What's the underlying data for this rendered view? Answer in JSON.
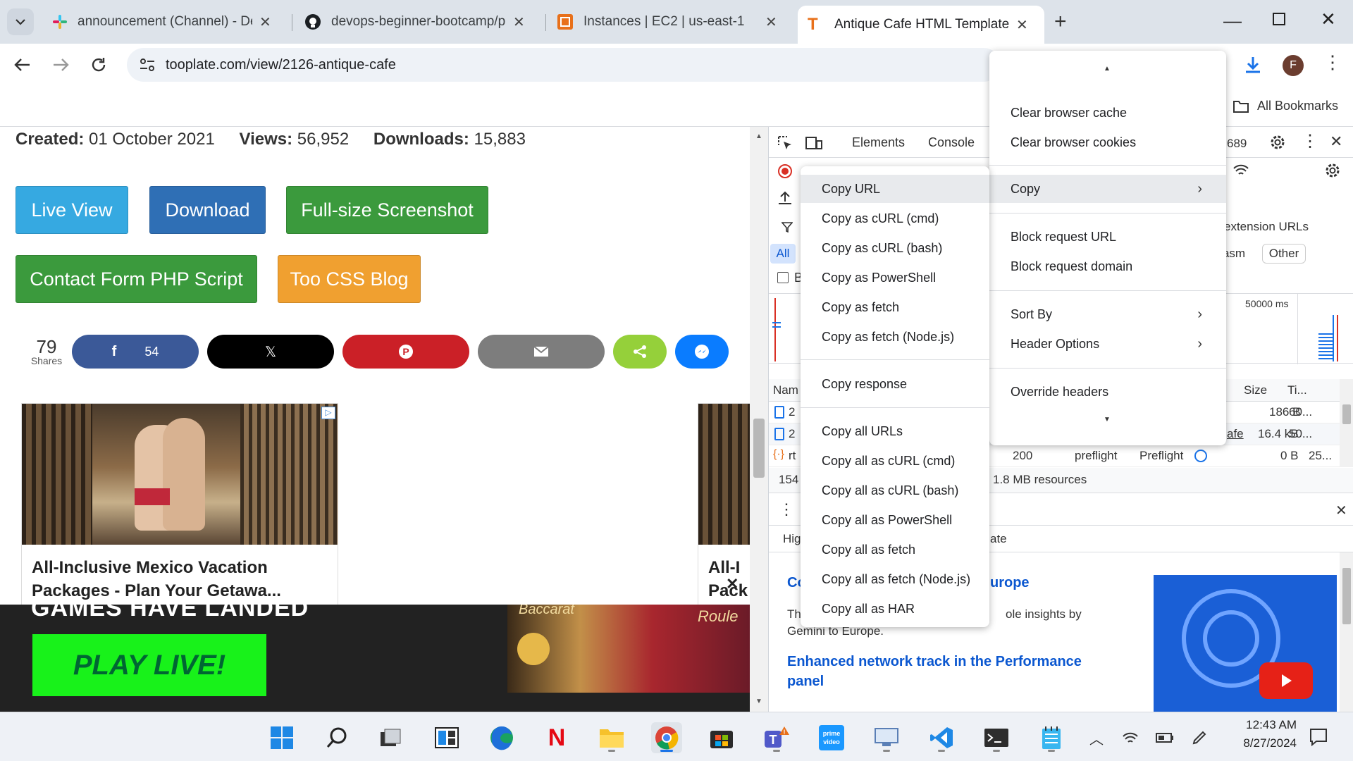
{
  "browser": {
    "tabs": [
      {
        "title": "announcement (Channel) - Dev",
        "icon": "slack-icon"
      },
      {
        "title": "devops-beginner-bootcamp/pr",
        "icon": "github-icon"
      },
      {
        "title": "Instances | EC2 | us-east-1",
        "icon": "aws-icon"
      },
      {
        "title": "Antique Cafe HTML Template b",
        "icon": "tooplate-icon"
      }
    ],
    "new_tab": "+",
    "url": "tooplate.com/view/2126-antique-cafe",
    "profile_initial": "F",
    "bookmarks_label": "All Bookmarks"
  },
  "page": {
    "meta": {
      "created_label": "Created:",
      "created": "01 October 2021",
      "views_label": "Views:",
      "views": "56,952",
      "downloads_label": "Downloads:",
      "downloads": "15,883"
    },
    "buttons": {
      "live_view": "Live View",
      "download": "Download",
      "screenshot": "Full-size Screenshot",
      "contact": "Contact Form PHP Script",
      "blog": "Too CSS Blog"
    },
    "shares": {
      "count": "79",
      "label": "Shares",
      "facebook_count": "54"
    },
    "ad": {
      "title": "All-Inclusive Mexico Vacation Packages - Plan Your Getawa...",
      "title2": "All-I",
      "title2b": "Pack",
      "banner_heading": "GAMES HAVE LANDED",
      "banner_cta": "PLAY LIVE!",
      "banner_side1": "Baccarat",
      "banner_side2": "Roule",
      "close": "✕"
    }
  },
  "devtools": {
    "tabs": {
      "elements": "Elements",
      "console": "Console"
    },
    "issues_count": "689",
    "filter_all": "All",
    "filter_b": "B",
    "extension_urls": "extension URLs",
    "chip_wasm": "asm",
    "chip_other": "Other",
    "timeline_label": "50000 ms",
    "columns": {
      "name": "Nam",
      "size": "Size",
      "time": "Ti..."
    },
    "rows": [
      {
        "name": "2",
        "size": "186 B",
        "time": "60..."
      },
      {
        "name": "2",
        "extra": "afe",
        "size": "16.4 kB",
        "time": "50..."
      },
      {
        "name": "rt",
        "status": "200",
        "type": "preflight",
        "initiator": "Preflight",
        "size": "0 B",
        "time": "25..."
      }
    ],
    "summary_count": "154",
    "summary_resources": "1.8 MB resources",
    "drawer": {
      "left_text": "Hig",
      "right_text": "ate",
      "heading1_a": "Co",
      "heading1_b": "urope",
      "body_a": "This",
      "body_b": "ole insights by",
      "body_c": "Gemini to Europe.",
      "heading2": "Enhanced network track in the Performance",
      "heading2b": "panel"
    }
  },
  "context_menu": {
    "items": [
      "Clear browser cache",
      "Clear browser cookies",
      "Copy",
      "Block request URL",
      "Block request domain",
      "Sort By",
      "Header Options",
      "Override headers"
    ]
  },
  "copy_submenu": {
    "items": [
      "Copy URL",
      "Copy as cURL (cmd)",
      "Copy as cURL (bash)",
      "Copy as PowerShell",
      "Copy as fetch",
      "Copy as fetch (Node.js)",
      "Copy response",
      "Copy all URLs",
      "Copy all as cURL (cmd)",
      "Copy all as cURL (bash)",
      "Copy all as PowerShell",
      "Copy all as fetch",
      "Copy all as fetch (Node.js)",
      "Copy all as HAR"
    ]
  },
  "taskbar": {
    "time": "12:43 AM",
    "date": "8/27/2024",
    "apps": [
      "start-icon",
      "search-icon",
      "task-view-icon",
      "widgets-icon",
      "edge-icon",
      "netflix-icon",
      "file-explorer-icon",
      "chrome-icon",
      "store-icon",
      "teams-icon",
      "prime-video-icon",
      "remote-desktop-icon",
      "vscode-icon",
      "terminal-icon",
      "notepad-icon"
    ]
  },
  "colors": {
    "live_view": "#36a9e1",
    "download": "#2f6fb5",
    "green": "#3b9a3d",
    "blog": "#f0a030",
    "facebook": "#3b5998",
    "x": "#000000",
    "pinterest": "#cb2027",
    "email": "#7d7d7d",
    "sharethis": "#95d03a",
    "messenger": "#0a7cff"
  }
}
